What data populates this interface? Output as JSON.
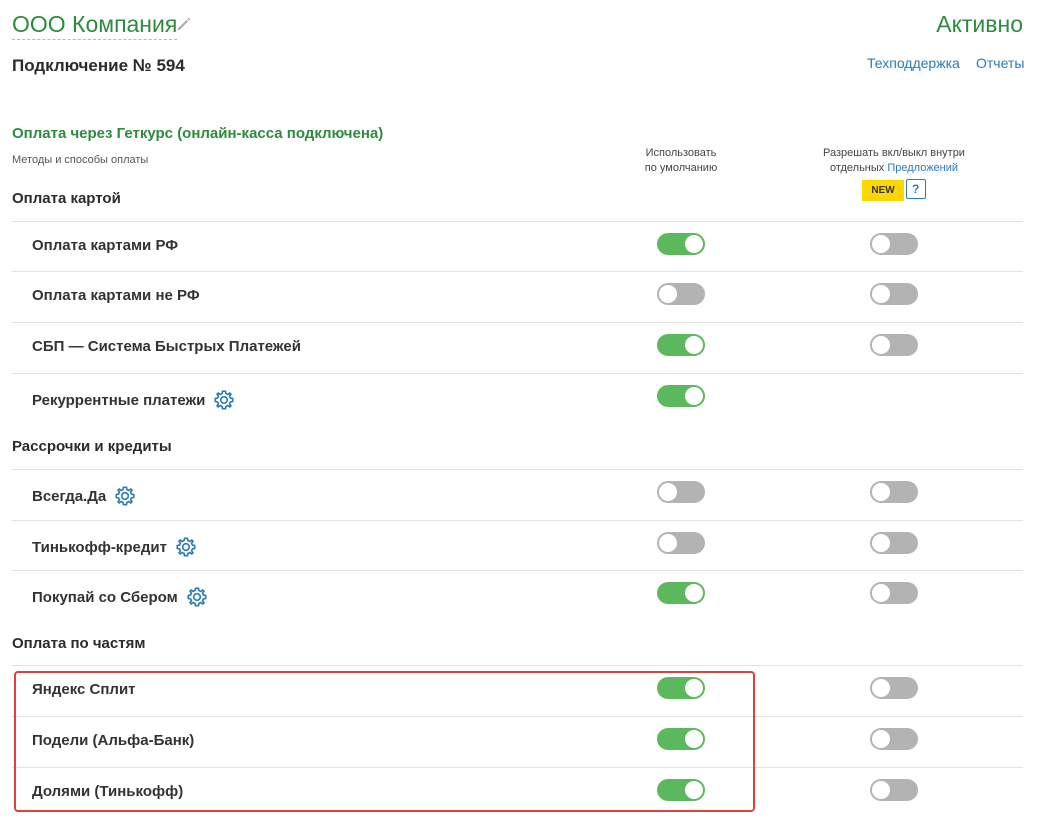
{
  "header": {
    "company": "ООО Компания",
    "status": "Активно",
    "connection_title": "Подключение № 594",
    "links": [
      "Техподдержка",
      "Отчеты"
    ]
  },
  "payment": {
    "section_title": "Оплата через Геткурс (онлайн-касса подключена)",
    "methods_subtitle": "Методы и способы оплаты",
    "col_default_line1": "Использовать",
    "col_default_line2": "по умолчанию",
    "col_allow_line1": "Разрешать вкл/выкл внутри",
    "col_allow_line2_prefix": "отдельных ",
    "col_allow_link": "Предложений",
    "badge_new": "NEW",
    "help": "?"
  },
  "groups": [
    {
      "title": "Оплата картой",
      "items": [
        {
          "label": "Оплата картами РФ",
          "gear": false,
          "default_on": true,
          "allow": "off"
        },
        {
          "label": "Оплата картами не РФ",
          "gear": false,
          "default_on": false,
          "allow": "off"
        },
        {
          "label": "СБП — Система Быстрых Платежей",
          "gear": false,
          "default_on": true,
          "allow": "off"
        },
        {
          "label": "Рекуррентные платежи",
          "gear": true,
          "default_on": true,
          "allow": "none"
        }
      ]
    },
    {
      "title": "Рассрочки и кредиты",
      "items": [
        {
          "label": "Всегда.Да",
          "gear": true,
          "default_on": false,
          "allow": "off"
        },
        {
          "label": "Тинькофф-кредит",
          "gear": true,
          "default_on": false,
          "allow": "off"
        },
        {
          "label": "Покупай со Сбером",
          "gear": true,
          "default_on": true,
          "allow": "off"
        }
      ]
    },
    {
      "title": "Оплата по частям",
      "items": [
        {
          "label": "Яндекс Сплит",
          "gear": false,
          "default_on": true,
          "allow": "off"
        },
        {
          "label": "Подели (Альфа-Банк)",
          "gear": false,
          "default_on": true,
          "allow": "off"
        },
        {
          "label": "Долями (Тинькофф)",
          "gear": false,
          "default_on": true,
          "allow": "off"
        }
      ]
    }
  ],
  "colors": {
    "accent_green": "#2e8b3e",
    "toggle_on": "#5cb85c",
    "toggle_off": "#b3b3b3",
    "link": "#2a7bb8",
    "highlight": "#e0413a"
  },
  "icons": {
    "edit": "pencil-icon",
    "settings": "gear-icon"
  }
}
